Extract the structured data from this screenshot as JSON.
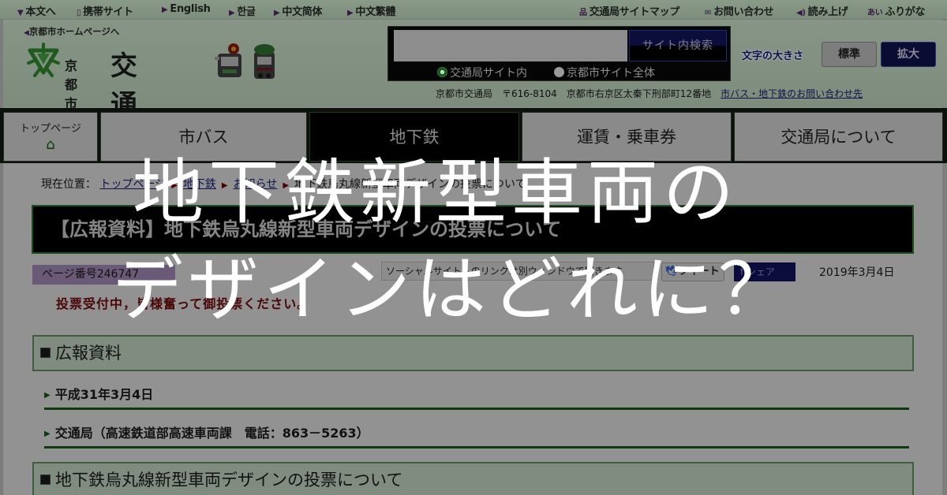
{
  "topbar": {
    "left": [
      {
        "icon": "skip-down-icon",
        "glyph": "▼",
        "label": "本文へ"
      },
      {
        "icon": "mobile-icon",
        "glyph": "▯",
        "label": "携帯サイト"
      },
      {
        "icon": "triangle-right-icon",
        "glyph": "▶",
        "label": "English"
      },
      {
        "icon": "triangle-right-icon",
        "glyph": "▶",
        "label": "한글"
      },
      {
        "icon": "triangle-right-icon",
        "glyph": "▶",
        "label": "中文简体"
      },
      {
        "icon": "triangle-right-icon",
        "glyph": "▶",
        "label": "中文繁體"
      }
    ],
    "right": [
      {
        "icon": "sitemap-icon",
        "glyph": "品",
        "label": "交通局サイトマップ"
      },
      {
        "icon": "mail-icon",
        "glyph": "✉",
        "label": "お問い合わせ"
      },
      {
        "icon": "speaker-icon",
        "glyph": "◀)",
        "label": "読み上げ"
      },
      {
        "icon": "furigana-icon",
        "glyph": "あい",
        "label": "ふりがな"
      }
    ]
  },
  "header": {
    "city_home_link": "京都市ホームページへ",
    "logo_city": "京都市",
    "logo_name": "交通局",
    "search": {
      "placeholder": "",
      "value": "",
      "button": "サイト内検索",
      "scope_options": [
        "交通局サイト内",
        "京都市サイト全体"
      ],
      "scope_selected": "交通局サイト内"
    },
    "font_size": {
      "label": "文字の大きさ",
      "standard": "標準",
      "large": "拡大"
    },
    "address": {
      "org": "京都市交通局",
      "postal": "〒616-8104",
      "street": "京都市右京区太秦下刑部町12番地",
      "contact_link": "市バス・地下鉄のお問い合わせ先"
    }
  },
  "nav": {
    "top_page": "トップページ",
    "items": [
      {
        "label": "市バス",
        "active": false
      },
      {
        "label": "地下鉄",
        "active": true
      },
      {
        "label": "運賃・乗車券",
        "active": false
      },
      {
        "label": "交通局について",
        "active": false
      }
    ]
  },
  "breadcrumb": {
    "prefix": "現在位置：",
    "links": [
      "トップページ",
      "地下鉄",
      "お知らせ"
    ],
    "current": "地下鉄烏丸線新型車両デザインの投票について"
  },
  "main": {
    "title": "【広報資料】地下鉄烏丸線新型車両デザインの投票について",
    "page_number": "ページ番号246747",
    "social_note": "ソーシャルサイトへのリンクは別ウィンドウで開きます",
    "tweet": "ツイート",
    "share": "シェア",
    "date": "2019年3月4日",
    "voting_note": "投票受付中，皆様奮って御投票ください。",
    "section1": "広報資料",
    "info_date": "平成31年3月4日",
    "info_dept": "交通局（高速鉄道部高速車両課　電話：863－5263）",
    "section2": "地下鉄烏丸線新型車両デザインの投票について"
  },
  "overlay": {
    "line1": "地下鉄新型車両の",
    "line2": "デザインはどれに？"
  },
  "colors": {
    "accent_green": "#0f3a10",
    "nav_active": "#000000",
    "font_large_btn": "#0b0c33",
    "page_no_badge": "#6a5977",
    "voting_note": "#4a0606",
    "overlay_text": "#ffffff"
  }
}
